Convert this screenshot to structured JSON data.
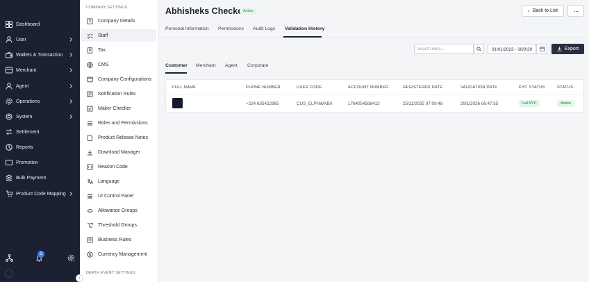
{
  "nav": {
    "items": [
      {
        "label": "Dashboard",
        "icon": "grid-icon",
        "has_children": false
      },
      {
        "label": "User",
        "icon": "user-icon",
        "has_children": true
      },
      {
        "label": "Wallets & Transaction",
        "icon": "wallet-icon",
        "has_children": true
      },
      {
        "label": "Merchant",
        "icon": "store-icon",
        "has_children": true
      },
      {
        "label": "Agent",
        "icon": "agent-icon",
        "has_children": true
      },
      {
        "label": "Operations",
        "icon": "operations-icon",
        "has_children": true
      },
      {
        "label": "System",
        "icon": "system-icon",
        "has_children": true
      },
      {
        "label": "Settlement",
        "icon": "settlement-icon",
        "has_children": false
      },
      {
        "label": "Reports",
        "icon": "reports-icon",
        "has_children": false
      },
      {
        "label": "Promotion",
        "icon": "promotion-icon",
        "has_children": false
      },
      {
        "label": "Bulk Payment",
        "icon": "bulk-payment-icon",
        "has_children": false
      },
      {
        "label": "Product Code Mapping",
        "icon": "product-code-icon",
        "has_children": true
      }
    ],
    "notification_count": "2"
  },
  "settings": {
    "heading": "COMPANY SETTINGS",
    "footer_heading": "DEATH EVENT SETTINGS",
    "items": [
      {
        "label": "Company Details"
      },
      {
        "label": "Staff"
      },
      {
        "label": "Tax"
      },
      {
        "label": "CMS"
      },
      {
        "label": "Company Configurations"
      },
      {
        "label": "Notification Rules"
      },
      {
        "label": "Maker Checker"
      },
      {
        "label": "Roles and Permissions"
      },
      {
        "label": "Product Release Notes"
      },
      {
        "label": "Download Manager"
      },
      {
        "label": "Reason Code"
      },
      {
        "label": "Language"
      },
      {
        "label": "UI Control Panel"
      },
      {
        "label": "Allowance Groups"
      },
      {
        "label": "Threshold Groups"
      },
      {
        "label": "Business Rules"
      },
      {
        "label": "Currency Management"
      }
    ],
    "active_index": 1
  },
  "header": {
    "title": "Abhisheks Checker",
    "status": "Active",
    "back_label": "Back to List",
    "more_label": "···"
  },
  "tabs": [
    "Personal Information",
    "Permissions",
    "Audit Logs",
    "Validation History"
  ],
  "active_tab": "Validation History",
  "toolbar": {
    "search_placeholder": "Search Here...",
    "date_range": "01/01/2023 - 30/0/20",
    "export_label": "Export"
  },
  "subtabs": [
    "Customer",
    "Merchant",
    "Agent",
    "Corporate"
  ],
  "active_subtab": "Customer",
  "table": {
    "columns": [
      "FULL NAME",
      "PHONE NUMBER",
      "USER CODE",
      "ACCOUNT NUMBER",
      "REGISTERED DATE",
      "VALIDATION DATE",
      "KYC STATUS",
      "STATUS"
    ],
    "rows": [
      {
        "full_name": "",
        "phone": "+224 635422985",
        "user_code": "CUS_ELPNWXB0",
        "account_number": "1764054588413",
        "registered_date": "25/11/2025 07:09:48",
        "validation_date": "29/1/2026 06:47:55",
        "kyc_status": "Full KYC",
        "status": "Active"
      }
    ]
  },
  "colors": {
    "nav_bg": "#1b2033",
    "accent_dark": "#2a2f40",
    "success_bg": "#e4f6ea",
    "success_text": "#1f8a4c"
  }
}
